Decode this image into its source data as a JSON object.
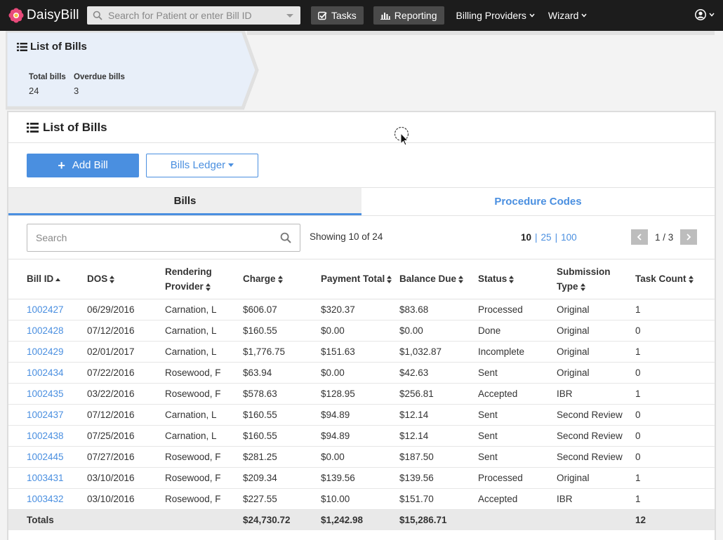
{
  "app": {
    "name": "DaisyBill"
  },
  "navbar": {
    "search_placeholder": "Search for Patient or enter Bill ID",
    "tasks_label": "Tasks",
    "reporting_label": "Reporting",
    "billing_providers_label": "Billing Providers",
    "wizard_label": "Wizard"
  },
  "header_card": {
    "title": "List of Bills",
    "stats": [
      {
        "label": "Total bills",
        "value": "24"
      },
      {
        "label": "Overdue bills",
        "value": "3"
      }
    ]
  },
  "panel": {
    "title": "List of Bills",
    "add_bill_label": "Add Bill",
    "ledger_label": "Bills Ledger",
    "tabs": [
      {
        "label": "Bills",
        "active": true
      },
      {
        "label": "Procedure Codes",
        "active": false
      }
    ],
    "search_placeholder": "Search",
    "showing": "Showing 10 of 24",
    "page_sizes": [
      "10",
      "25",
      "100"
    ],
    "page_size_selected": "10",
    "page_indicator": "1 / 3"
  },
  "table": {
    "columns": [
      {
        "label": "Bill ID",
        "sort": "asc"
      },
      {
        "label": "DOS",
        "sort": "both"
      },
      {
        "label": "Rendering Provider",
        "sort": "both"
      },
      {
        "label": "Charge",
        "sort": "both"
      },
      {
        "label": "Payment Total",
        "sort": "both"
      },
      {
        "label": "Balance Due",
        "sort": "both"
      },
      {
        "label": "Status",
        "sort": "both"
      },
      {
        "label": "Submission Type",
        "sort": "both"
      },
      {
        "label": "Task Count",
        "sort": "both"
      }
    ],
    "rows": [
      [
        "1002427",
        "06/29/2016",
        "Carnation, L",
        "$606.07",
        "$320.37",
        "$83.68",
        "Processed",
        "Original",
        "1"
      ],
      [
        "1002428",
        "07/12/2016",
        "Carnation, L",
        "$160.55",
        "$0.00",
        "$0.00",
        "Done",
        "Original",
        "0"
      ],
      [
        "1002429",
        "02/01/2017",
        "Carnation, L",
        "$1,776.75",
        "$151.63",
        "$1,032.87",
        "Incomplete",
        "Original",
        "1"
      ],
      [
        "1002434",
        "07/22/2016",
        "Rosewood, F",
        "$63.94",
        "$0.00",
        "$42.63",
        "Sent",
        "Original",
        "0"
      ],
      [
        "1002435",
        "03/22/2016",
        "Rosewood, F",
        "$578.63",
        "$128.95",
        "$256.81",
        "Accepted",
        "IBR",
        "1"
      ],
      [
        "1002437",
        "07/12/2016",
        "Carnation, L",
        "$160.55",
        "$94.89",
        "$12.14",
        "Sent",
        "Second Review",
        "0"
      ],
      [
        "1002438",
        "07/25/2016",
        "Carnation, L",
        "$160.55",
        "$94.89",
        "$12.14",
        "Sent",
        "Second Review",
        "0"
      ],
      [
        "1002445",
        "07/27/2016",
        "Rosewood, F",
        "$281.25",
        "$0.00",
        "$187.50",
        "Sent",
        "Second Review",
        "0"
      ],
      [
        "1003431",
        "03/10/2016",
        "Rosewood, F",
        "$209.34",
        "$139.56",
        "$139.56",
        "Processed",
        "Original",
        "1"
      ],
      [
        "1003432",
        "03/10/2016",
        "Rosewood, F",
        "$227.55",
        "$10.00",
        "$151.70",
        "Accepted",
        "IBR",
        "1"
      ]
    ],
    "totals": [
      "Totals",
      "",
      "",
      "$24,730.72",
      "$1,242.98",
      "$15,286.71",
      "",
      "",
      "12"
    ]
  },
  "colors": {
    "accent": "#4a8fe0",
    "navbar": "#1c1c1c",
    "header_card": "#e8eff9"
  }
}
